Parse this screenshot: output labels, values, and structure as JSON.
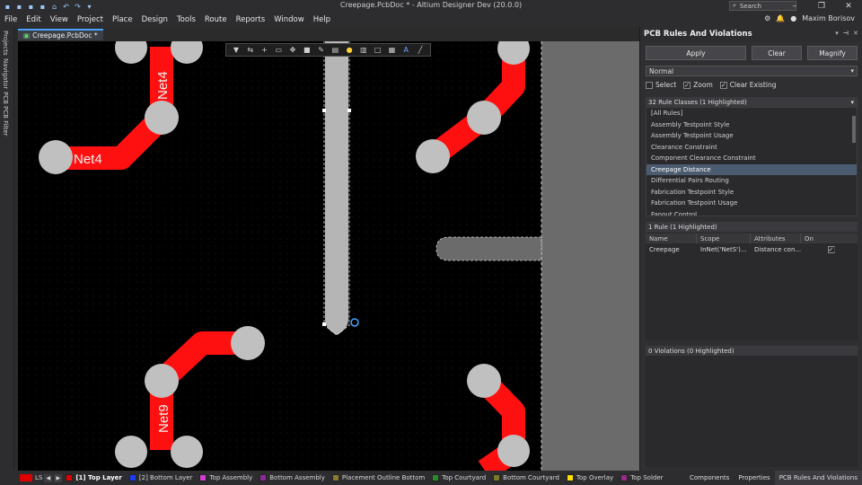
{
  "window": {
    "title": "Creepage.PcbDoc * - Altium Designer Dev (20.0.0)",
    "search_placeholder": "Search",
    "user": "Maxim Borisov"
  },
  "menu": [
    "File",
    "Edit",
    "View",
    "Project",
    "Place",
    "Design",
    "Tools",
    "Route",
    "Reports",
    "Window",
    "Help"
  ],
  "left_tabs": [
    "Projects",
    "Navigator",
    "PCB",
    "PCB Filter"
  ],
  "doc_tab": "Creepage.PcbDoc *",
  "canvas": {
    "net_labels": [
      "Net4",
      "Net4",
      "Net9"
    ],
    "colors": {
      "track": "#ff1010",
      "pad": "#c0c0c0",
      "board_edge": "#6b6b6b",
      "background": "#000000"
    }
  },
  "panel": {
    "title": "PCB Rules And Violations",
    "apply": "Apply",
    "clear": "Clear",
    "magnify": "Magnify",
    "mode": "Normal",
    "checks": [
      {
        "label": "Select",
        "checked": false
      },
      {
        "label": "Zoom",
        "checked": true
      },
      {
        "label": "Clear Existing",
        "checked": true
      }
    ],
    "classes_header": "32 Rule Classes (1 Highlighted)",
    "classes": [
      "[All Rules]",
      "Assembly Testpoint Style",
      "Assembly Testpoint Usage",
      "Clearance Constraint",
      "Component Clearance Constraint",
      "Creepage Distance",
      "Differential Pairs Routing",
      "Fabrication Testpoint Style",
      "Fabrication Testpoint Usage",
      "Fanout Control"
    ],
    "selected_class": "Creepage Distance",
    "rules_header": "1 Rule (1 Highlighted)",
    "columns": [
      "Name",
      "Scope",
      "Attributes",
      "On"
    ],
    "rule": {
      "name": "Creepage",
      "scope": "InNet('NetS')...",
      "attributes": "Distance con...",
      "on": true
    },
    "violations_header": "0 Violations (0 Highlighted)"
  },
  "status": {
    "ls": "LS",
    "layers": [
      {
        "name": "[1] Top Layer",
        "color": "#e00000",
        "active": true
      },
      {
        "name": "[2] Bottom Layer",
        "color": "#1a3cff",
        "active": false
      },
      {
        "name": "Top Assembly",
        "color": "#d43cd4",
        "active": false
      },
      {
        "name": "Bottom Assembly",
        "color": "#8a2a9a",
        "active": false
      },
      {
        "name": "Placement Outline Bottom",
        "color": "#8b7b30",
        "active": false
      },
      {
        "name": "Top Courtyard",
        "color": "#2a8a2a",
        "active": false
      },
      {
        "name": "Bottom Courtyard",
        "color": "#7a7a2a",
        "active": false
      },
      {
        "name": "Top Overlay",
        "color": "#ffe000",
        "active": false
      },
      {
        "name": "Top Solder",
        "color": "#9a2a8a",
        "active": false
      }
    ],
    "right_tabs": [
      "Components",
      "Properties",
      "PCB Rules And Violations"
    ]
  }
}
